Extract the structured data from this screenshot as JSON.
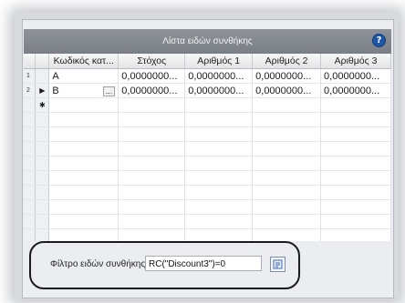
{
  "header": {
    "title": "Λίστα ειδών συνθήκης",
    "help": "?"
  },
  "grid": {
    "columns": [
      "Κωδικός κατ...",
      "Στόχος",
      "Αριθμός 1",
      "Αριθμός 2",
      "Αριθμός 3"
    ],
    "rows": [
      {
        "num": "1",
        "marker": "",
        "cells": [
          "A",
          "0,0000000...",
          "0,0000000...",
          "0,0000000...",
          "0,0000000..."
        ]
      },
      {
        "num": "2",
        "marker": "▶",
        "cells": [
          "B",
          "0,0000000...",
          "0,0000000...",
          "0,0000000...",
          "0,0000000..."
        ],
        "ellipsis": "..."
      },
      {
        "num": "",
        "marker": "✱",
        "cells": [
          "",
          "",
          "",
          "",
          ""
        ]
      }
    ]
  },
  "filter": {
    "label": "Φίλτρο ειδών συνθήκης",
    "value": "RC(\"Discount3\")=0"
  }
}
